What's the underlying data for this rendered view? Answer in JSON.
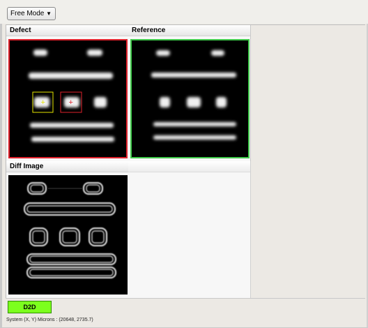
{
  "toolbar": {
    "mode_value": "Free Mode",
    "arrow_glyph": "▼"
  },
  "panels": {
    "defect": {
      "title": "Defect",
      "border_color": "#e0222c"
    },
    "reference": {
      "title": "Reference",
      "border_color": "#3fc94a"
    },
    "diff": {
      "title": "Diff Image"
    }
  },
  "markers": {
    "defect_box_color": "#e6e600",
    "defect_box2_color": "#e0222c",
    "glyph": "+"
  },
  "status": {
    "mode_button_label": "D2D",
    "mode_button_color": "#7cff1d",
    "coordinates_text": "System (X, Y) Microns : (20648, 2735.7)"
  }
}
